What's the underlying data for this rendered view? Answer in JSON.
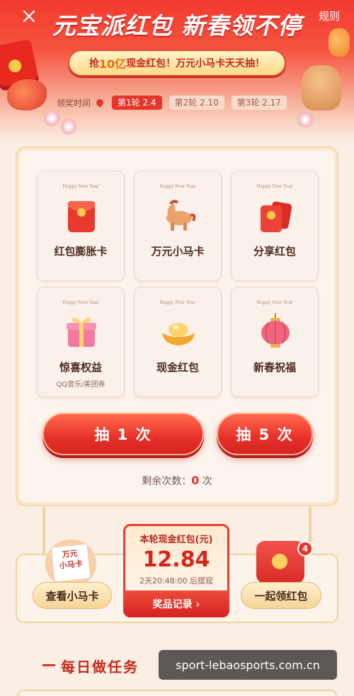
{
  "header": {
    "close_icon": "close-icon",
    "rules_label": "规则",
    "title": "元宝派红包 新春领不停",
    "banner": {
      "prefix": "抢",
      "highlight": "10亿",
      "suffix": "现金红包！万元小马卡天天抽！"
    }
  },
  "rounds": {
    "label": "领奖时间",
    "tabs": [
      {
        "label": "第1轮 2.4",
        "active": true
      },
      {
        "label": "第2轮 2.10",
        "active": false
      },
      {
        "label": "第3轮 2.17",
        "active": false
      }
    ]
  },
  "prizes": [
    {
      "caption": "Happy New Year",
      "name": "红包膨胀卡",
      "sub": "",
      "icon": "red-envelope-icon"
    },
    {
      "caption": "Happy New Year",
      "name": "万元小马卡",
      "sub": "",
      "icon": "horse-icon"
    },
    {
      "caption": "Happy New Year",
      "name": "分享红包",
      "sub": "",
      "icon": "share-envelope-icon"
    },
    {
      "caption": "Happy New Year",
      "name": "惊喜权益",
      "sub": "QQ音乐/美团券",
      "icon": "gift-box-icon"
    },
    {
      "caption": "Happy New Year",
      "name": "现金红包",
      "sub": "",
      "icon": "gold-ingot-icon"
    },
    {
      "caption": "Happy New Year",
      "name": "新春祝福",
      "sub": "",
      "icon": "lantern-icon"
    }
  ],
  "draw": {
    "draw_one_label": "抽 1 次",
    "draw_five_label": "抽 5 次",
    "remain_prefix": "剩余次数：",
    "remain_count": "0",
    "remain_suffix": " 次"
  },
  "bottom": {
    "horse_card_label": "查看小马卡",
    "horse_card_icon_text_1": "万元",
    "horse_card_icon_text_2": "小马卡",
    "cash_title": "本轮现金红包(元)",
    "cash_amount": "12.84",
    "cash_time": "2天20:48:00 后提现",
    "records_label": "奖品记录 ›",
    "together_label": "一起领红包",
    "together_badge": "4"
  },
  "footer": {
    "section_title": "每日做任务",
    "watermark": "sport-lebaosports.com.cn"
  },
  "colors": {
    "primary_red": "#e8352b",
    "gold": "#f6d497",
    "bg": "#fbeee4"
  }
}
